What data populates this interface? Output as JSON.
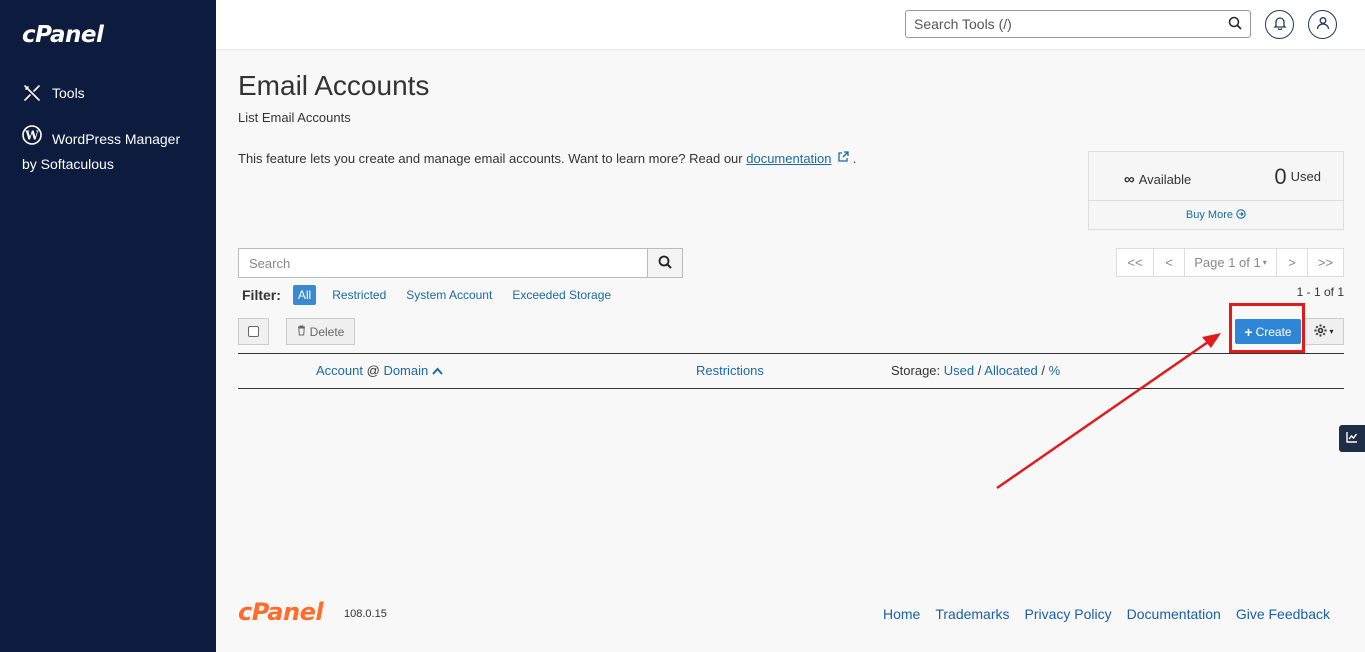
{
  "sidebar": {
    "logo": "cPanel",
    "items": [
      {
        "label": "Tools",
        "icon": "tools-icon"
      },
      {
        "label": "WordPress Manager",
        "label2": "by Softaculous",
        "icon": "wordpress-icon"
      }
    ]
  },
  "topbar": {
    "search_placeholder": "Search Tools (/)"
  },
  "page": {
    "title": "Email Accounts",
    "subtitle": "List Email Accounts",
    "intro_text": "This feature lets you create and manage email accounts. Want to learn more? Read our ",
    "intro_link": "documentation",
    "intro_end": " ."
  },
  "quota": {
    "available_symbol": "∞",
    "available_label": "Available",
    "used_value": "0",
    "used_label": "Used",
    "buy_more": "Buy More"
  },
  "search": {
    "placeholder": "Search"
  },
  "pagination": {
    "first": "<<",
    "prev": "<",
    "page_label": "Page 1 of 1",
    "next": ">",
    "last": ">>",
    "count": "1 - 1 of 1"
  },
  "filter": {
    "label": "Filter:",
    "options": [
      "All",
      "Restricted",
      "System Account",
      "Exceeded Storage"
    ],
    "active": "All"
  },
  "toolbar": {
    "delete_label": "Delete",
    "create_label": "Create"
  },
  "table": {
    "col_account": "Account",
    "col_at": "@",
    "col_domain": "Domain",
    "col_restrictions": "Restrictions",
    "col_storage": "Storage:",
    "col_used": "Used",
    "col_sep1": "/",
    "col_allocated": "Allocated",
    "col_sep2": "/",
    "col_percent": "%"
  },
  "footer": {
    "logo": "cPanel",
    "version": "108.0.15",
    "links": [
      "Home",
      "Trademarks",
      "Privacy Policy",
      "Documentation",
      "Give Feedback"
    ]
  },
  "colors": {
    "sidebar_bg": "#0d1b3f",
    "accent": "#2f86d6",
    "highlight": "#e01b1b",
    "footer_logo": "#ff6c2c"
  }
}
